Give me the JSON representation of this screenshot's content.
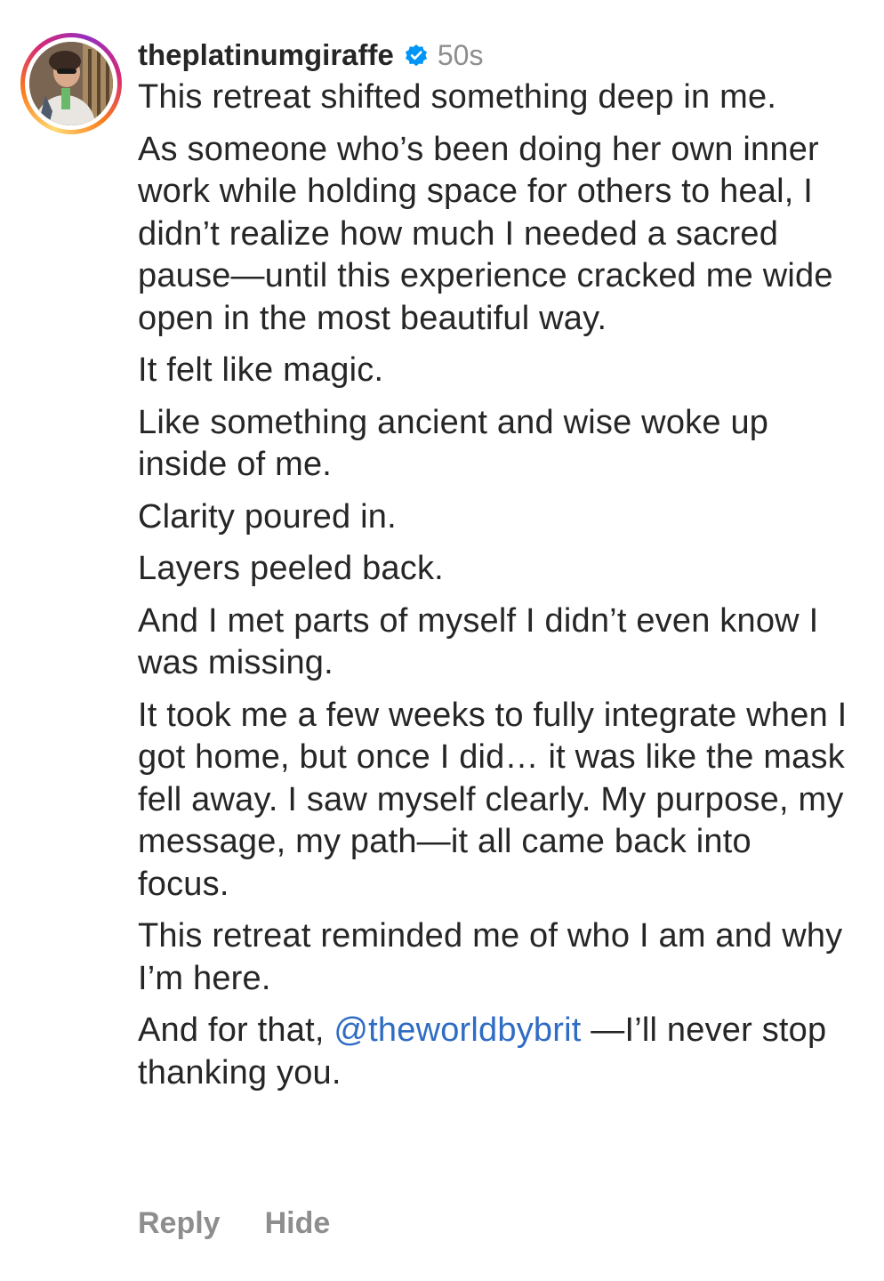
{
  "comment": {
    "username": "theplatinumgiraffe",
    "time": "50s",
    "verified_icon": "verified-badge-icon",
    "paragraphs": [
      "This retreat shifted something deep in me.",
      "As someone who’s been doing her own inner work while holding space for others to heal, I didn’t realize how much I needed a sacred pause—until this experience cracked me wide open in the most beautiful way.",
      "It felt like magic.",
      "Like something ancient and wise woke up inside of me.",
      "Clarity poured in.",
      "Layers peeled back.",
      "And I met parts of myself I didn’t even know I was missing.",
      "It took me a few weeks to fully integrate when I got home, but once I did… it was like the mask fell away. I saw myself clearly. My purpose, my message, my path—it all came back into focus.",
      "This retreat reminded me of who I am and why I’m here."
    ],
    "final_paragraph": {
      "before": "And for that, ",
      "mention": "@theworldbybrit",
      "after": " —I’ll never stop thanking you."
    },
    "actions": {
      "reply_label": "Reply",
      "hide_label": "Hide"
    }
  },
  "colors": {
    "text": "#262626",
    "muted": "#8e8e8e",
    "mention": "#2f6cc4",
    "verified": "#0095f6"
  }
}
